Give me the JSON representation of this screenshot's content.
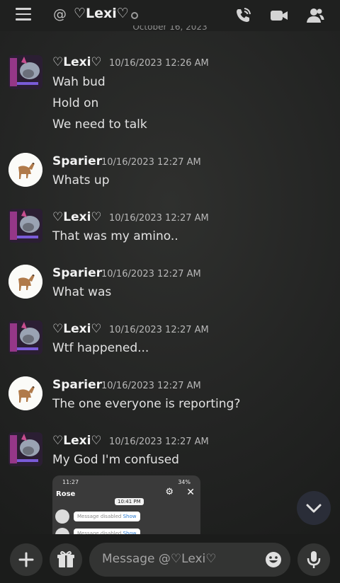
{
  "header": {
    "at_symbol": "@",
    "title": "♡Lexi♡",
    "date_peek": "October 16, 2023"
  },
  "messages": [
    {
      "author": "♡Lexi♡",
      "timestamp": "10/16/2023 12:26 AM",
      "lines": [
        "Wah bud",
        "Hold on",
        "We need to talk"
      ],
      "avatar": "lexi-avatar"
    },
    {
      "author": "Sparier",
      "timestamp": "10/16/2023 12:27 AM",
      "lines": [
        "Whats up"
      ],
      "avatar": "deer-avatar"
    },
    {
      "author": "♡Lexi♡",
      "timestamp": "10/16/2023 12:27 AM",
      "lines": [
        "That was my amino.."
      ],
      "avatar": "lexi-avatar"
    },
    {
      "author": "Sparier",
      "timestamp": "10/16/2023 12:27 AM",
      "lines": [
        "What was"
      ],
      "avatar": "deer-avatar"
    },
    {
      "author": "♡Lexi♡",
      "timestamp": "10/16/2023 12:27 AM",
      "lines": [
        "Wtf happened..."
      ],
      "avatar": "lexi-avatar"
    },
    {
      "author": "Sparier",
      "timestamp": "10/16/2023 12:27 AM",
      "lines": [
        "The one everyone is reporting?"
      ],
      "avatar": "deer-avatar"
    },
    {
      "author": "♡Lexi♡",
      "timestamp": "10/16/2023 12:27 AM",
      "lines": [
        "My God I'm confused"
      ],
      "avatar": "lexi-avatar"
    }
  ],
  "embed": {
    "status_time": "11:27",
    "status_right": "34%",
    "chat_title": "Rose",
    "time": "10:41 PM",
    "msg1": "Message disabled",
    "msg2": "Message disabled",
    "show": "Show"
  },
  "composer": {
    "placeholder": "Message @♡Lexi♡"
  },
  "icons": [
    "menu-icon",
    "call-icon",
    "video-icon",
    "members-icon",
    "chevron-down-icon",
    "plus-icon",
    "gift-icon",
    "emoji-icon",
    "mic-icon"
  ],
  "colors": {
    "background": "#232423",
    "accent": "#2a2d38"
  }
}
